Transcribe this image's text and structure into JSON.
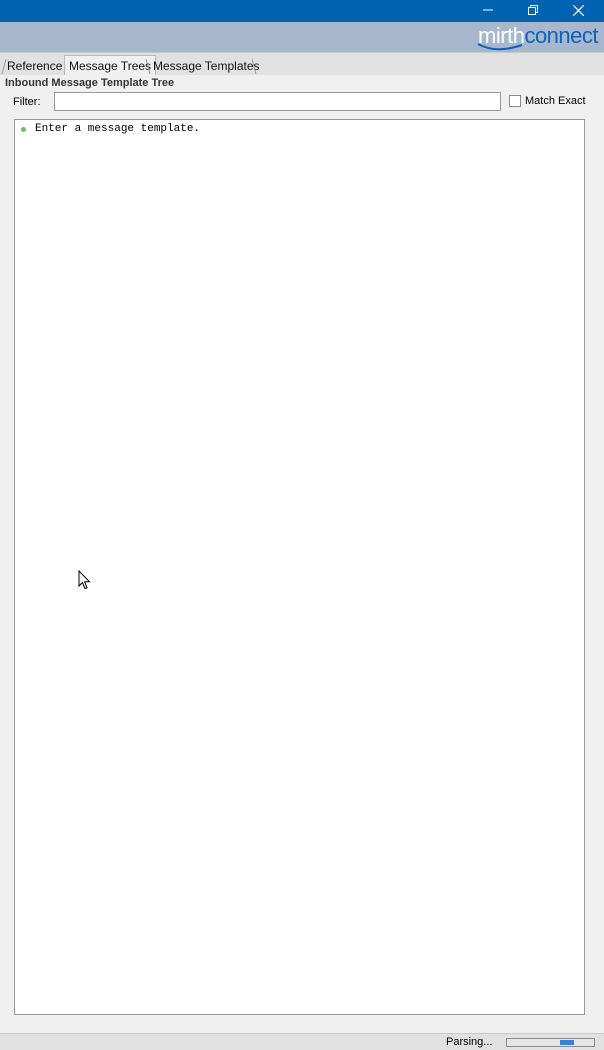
{
  "window": {
    "minimize_icon": "minimize-icon",
    "restore_icon": "restore-icon",
    "close_icon": "close-icon",
    "title_color": "#0063b1"
  },
  "banner": {
    "logo_part1": "mirth",
    "logo_part2": "connect",
    "background": "#a7b7ce"
  },
  "tabs": [
    {
      "label": "Reference",
      "active": false
    },
    {
      "label": "Message Trees",
      "active": true
    },
    {
      "label": "Message Templates",
      "active": false
    }
  ],
  "panel": {
    "title": "Inbound Message Template Tree",
    "filter_label": "Filter:",
    "filter_value": "",
    "match_exact_label": "Match Exact",
    "match_exact_checked": false,
    "tree_items": [
      {
        "text": "Enter a message template.",
        "icon": "green-dot-icon"
      }
    ]
  },
  "status": {
    "text": "Parsing...",
    "progress_indeterminate": true
  }
}
